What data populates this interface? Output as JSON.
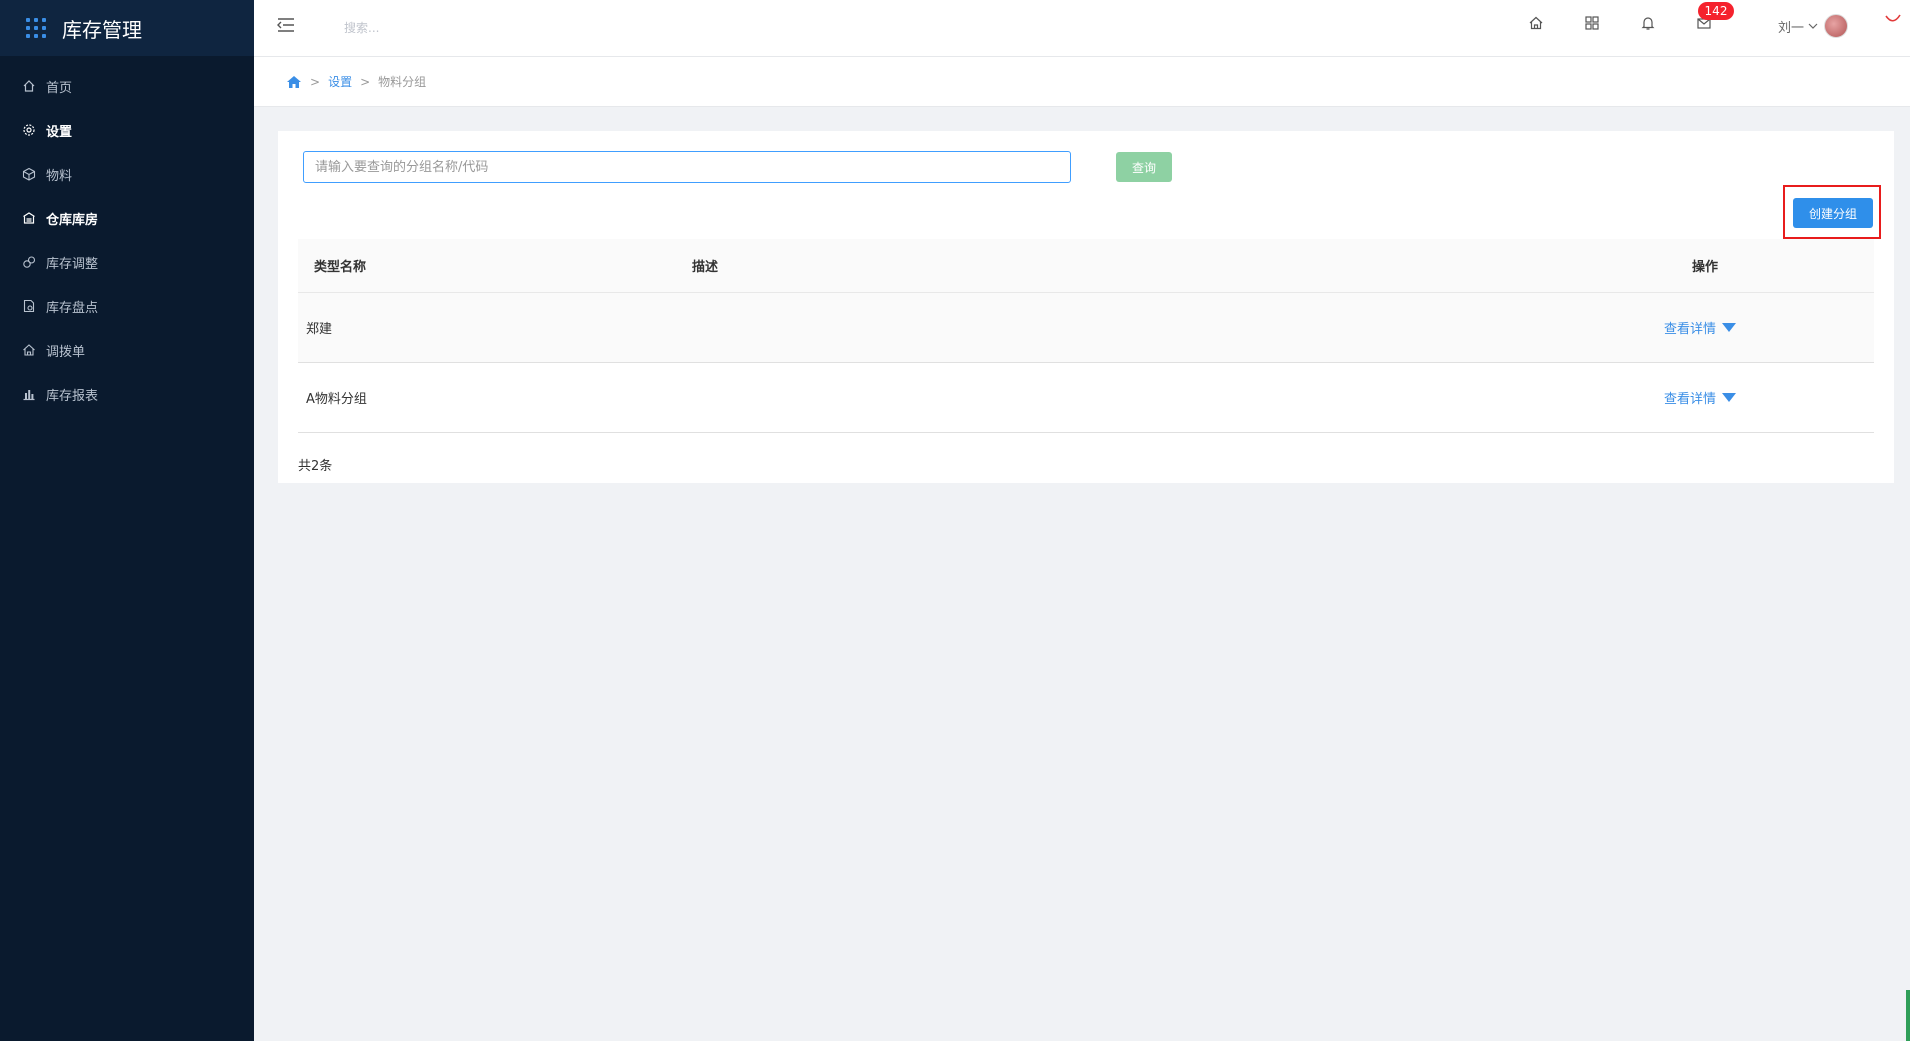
{
  "app": {
    "title": "库存管理"
  },
  "sidebar": {
    "items": [
      {
        "label": "首页",
        "icon": "home-icon",
        "active": false
      },
      {
        "label": "设置",
        "icon": "gear-icon",
        "active": true
      },
      {
        "label": "物料",
        "icon": "cube-icon",
        "active": false
      },
      {
        "label": "仓库库房",
        "icon": "warehouse-icon",
        "active": true
      },
      {
        "label": "库存调整",
        "icon": "adjust-icon",
        "active": false
      },
      {
        "label": "库存盘点",
        "icon": "inventory-check-icon",
        "active": false
      },
      {
        "label": "调拨单",
        "icon": "transfer-icon",
        "active": false
      },
      {
        "label": "库存报表",
        "icon": "bar-chart-icon",
        "active": false
      }
    ]
  },
  "topbar": {
    "search_placeholder": "搜索...",
    "mail_badge": "142",
    "user_name": "刘一"
  },
  "breadcrumb": {
    "sep": ">",
    "level1": "设置",
    "level2": "物料分组"
  },
  "filter": {
    "placeholder": "请输入要查询的分组名称/代码",
    "value": "",
    "query_label": "查询",
    "create_label": "创建分组"
  },
  "table": {
    "columns": {
      "name": "类型名称",
      "desc": "描述",
      "op": "操作"
    },
    "rows": [
      {
        "name": "郑建",
        "desc": "",
        "action": "查看详情"
      },
      {
        "name": "A物料分组",
        "desc": "",
        "action": "查看详情"
      }
    ],
    "total": "共2条"
  },
  "colors": {
    "sidebar_bg": "#0a1a2e",
    "accent": "#3a8ee6",
    "query_btn": "#8ed1a3",
    "create_btn": "#2f8fea",
    "highlight": "#e81c1c",
    "badge": "#f5222d"
  }
}
